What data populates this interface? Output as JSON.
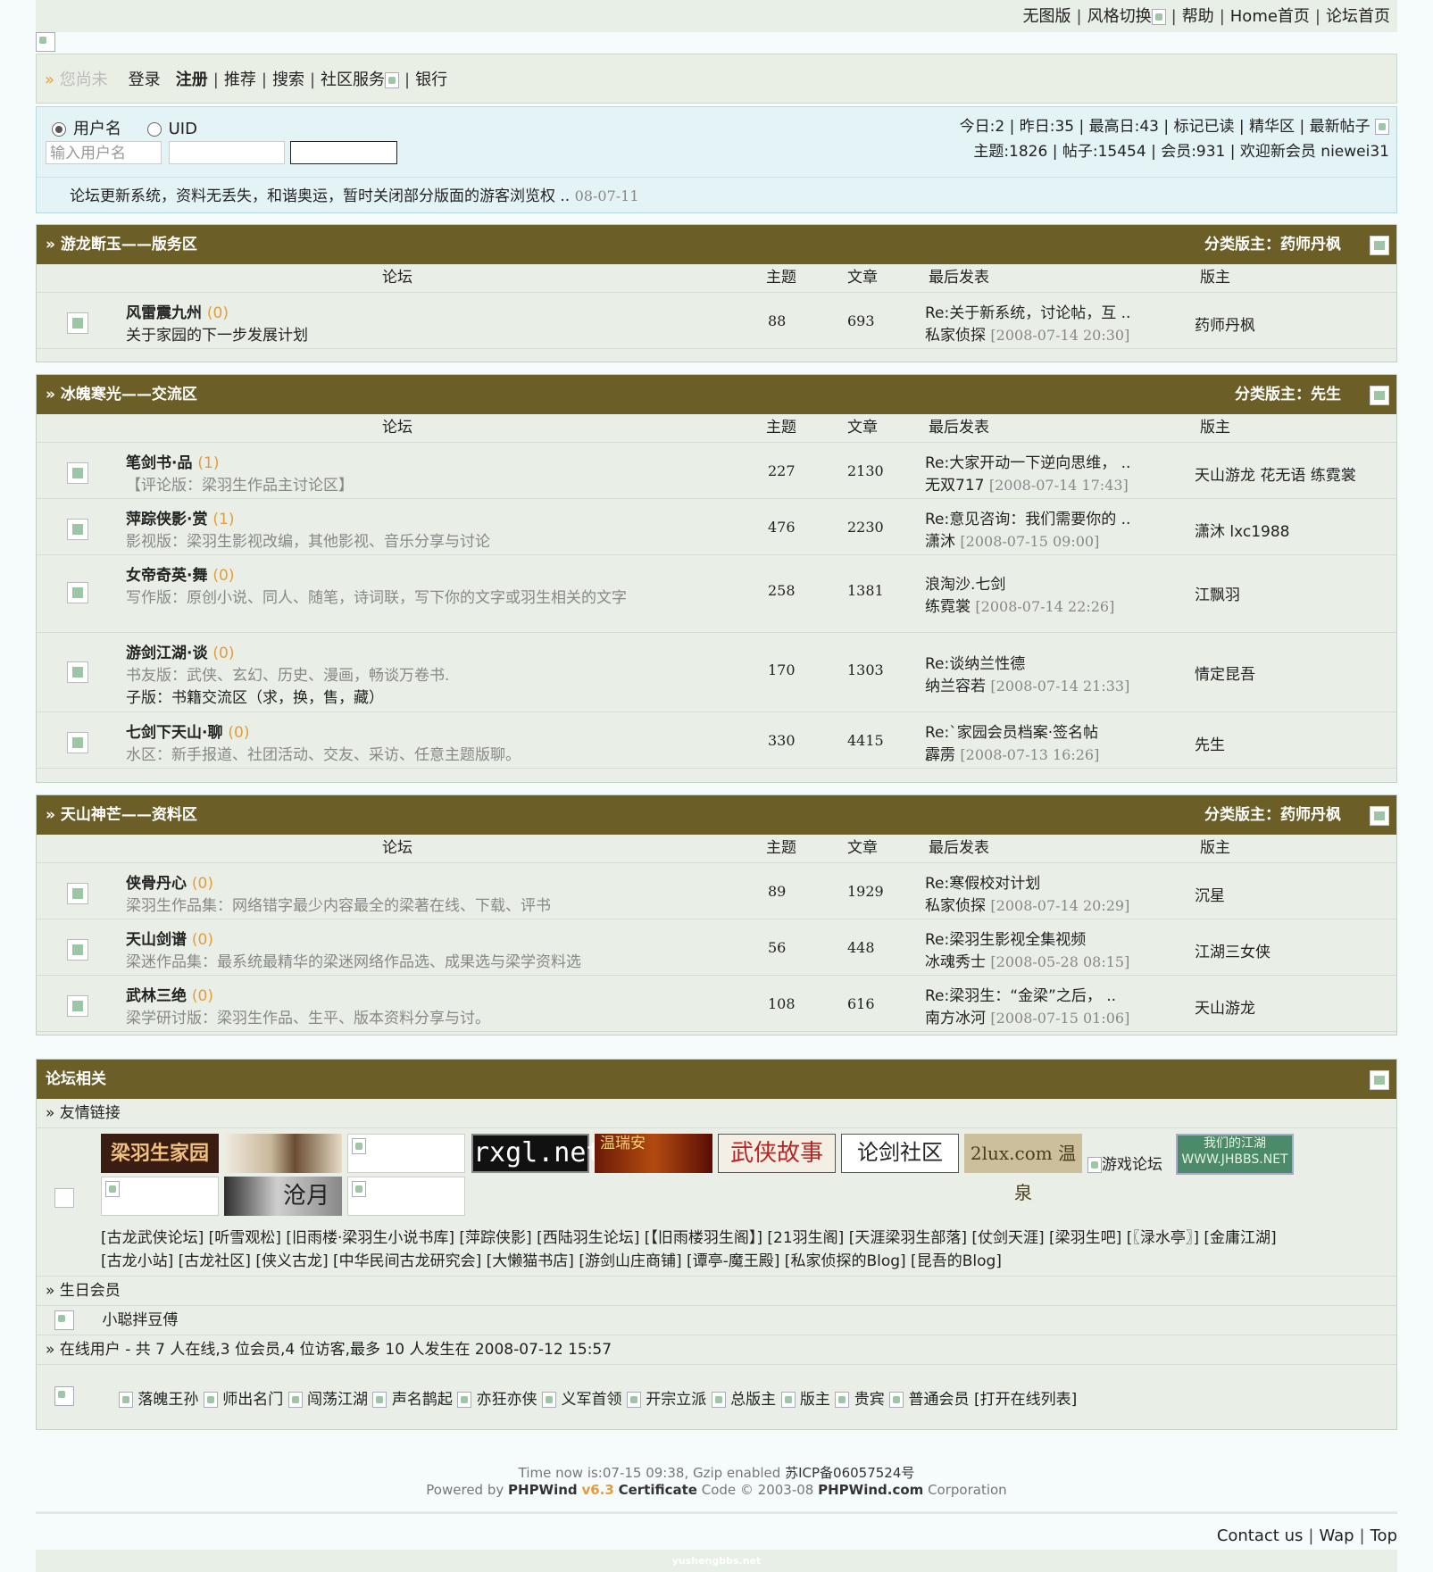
{
  "topbar": {
    "links": [
      "无图版",
      "风格切换",
      "帮助",
      "Home首页",
      "论坛首页"
    ]
  },
  "nav": {
    "greeting_prefix": "» ",
    "greeting": "您尚未",
    "login": "登录",
    "register": "注册",
    "recommend": "推荐",
    "search": "搜索",
    "community": "社区服务",
    "bank": "银行"
  },
  "login": {
    "radio_username": "用户名",
    "radio_uid": "UID",
    "username_placeholder": "输入用户名"
  },
  "stats": {
    "line1": "今日:2 | 昨日:35 | 最高日:43 | 标记已读 | 精华区 | 最新帖子",
    "line2": "主题:1826 | 帖子:15454 | 会员:931 | 欢迎新会员 niewei31"
  },
  "notice": {
    "text": "论坛更新系统，资料无丢失，和谐奥运，暂时关闭部分版面的游客浏览权 ..",
    "date": "08-07-11"
  },
  "columns": {
    "forum": "论坛",
    "topics": "主题",
    "posts": "文章",
    "last": "最后发表",
    "mods": "版主"
  },
  "sections": [
    {
      "title": "» 游龙断玉——版务区",
      "admin": "分类版主：药师丹枫",
      "forums": [
        {
          "name": "风雷震九州",
          "count": "(0)",
          "desc": "关于家园的下一步发展计划",
          "desc_dark": true,
          "topics": "88",
          "posts": "693",
          "last_title": "Re:关于新系统，讨论帖，互 ..",
          "last_user": "私家侦探",
          "last_time": "[2008-07-14 20:30]",
          "mods": "药师丹枫"
        }
      ]
    },
    {
      "title": "» 冰魄寒光——交流区",
      "admin": "分类版主：先生",
      "forums": [
        {
          "name": "笔剑书·品",
          "count": "(1)",
          "desc": "【评论版：梁羽生作品主讨论区】",
          "topics": "227",
          "posts": "2130",
          "last_title": "Re:大家开动一下逆向思维，  ..",
          "last_user": "无双717",
          "last_time": "[2008-07-14 17:43]",
          "mods": "天山游龙 花无语 练霓裳"
        },
        {
          "name": "萍踪侠影·赏",
          "count": "(1)",
          "desc": "影视版：梁羽生影视改编，其他影视、音乐分享与讨论",
          "topics": "476",
          "posts": "2230",
          "last_title": "Re:意见咨询：我们需要你的 ..",
          "last_user": "潇沐",
          "last_time": "[2008-07-15 09:00]",
          "mods": "潇沐 lxc1988"
        },
        {
          "name": "女帝奇英·舞",
          "count": "(0)",
          "desc": "写作版：原创小说、同人、随笔，诗词联，写下你的文字或羽生相关的文字",
          "topics": "258",
          "posts": "1381",
          "last_title": "浪淘沙.七剑",
          "last_user": "练霓裳",
          "last_time": "[2008-07-14 22:26]",
          "mods": "江飘羽"
        },
        {
          "name": "游剑江湖·谈",
          "count": "(0)",
          "desc": "书友版：武侠、玄幻、历史、漫画，畅谈万卷书.",
          "subforum": "子版：书籍交流区（求，换，售，藏）",
          "topics": "170",
          "posts": "1303",
          "last_title": "Re:谈纳兰性德",
          "last_user": "纳兰容若",
          "last_time": "[2008-07-14 21:33]",
          "mods": "情定昆吾"
        },
        {
          "name": "七剑下天山·聊",
          "count": "(0)",
          "desc": "水区：新手报道、社团活动、交友、采访、任意主题版聊。",
          "topics": "330",
          "posts": "4415",
          "last_title": "Re:`家园会员档案·签名帖",
          "last_user": "霹雳",
          "last_time": "[2008-07-13 16:26]",
          "mods": "先生"
        }
      ]
    },
    {
      "title": "» 天山神芒——资料区",
      "admin": "分类版主：药师丹枫",
      "forums": [
        {
          "name": "侠骨丹心",
          "count": "(0)",
          "desc": "梁羽生作品集：网络错字最少内容最全的梁著在线、下载、评书",
          "topics": "89",
          "posts": "1929",
          "last_title": "Re:寒假校对计划",
          "last_user": "私家侦探",
          "last_time": "[2008-07-14 20:29]",
          "mods": "沉星"
        },
        {
          "name": "天山剑谱",
          "count": "(0)",
          "desc": "梁迷作品集：最系统最精华的梁迷网络作品选、成果选与梁学资料选",
          "topics": "56",
          "posts": "448",
          "last_title": "Re:梁羽生影视全集视频",
          "last_user": "冰魂秀士",
          "last_time": "[2008-05-28 08:15]",
          "mods": "江湖三女侠"
        },
        {
          "name": "武林三绝",
          "count": "(0)",
          "desc": "梁学研讨版：梁羽生作品、生平、版本资料分享与讨。",
          "topics": "108",
          "posts": "616",
          "last_title": "Re:梁羽生：“金梁”之后，  ..",
          "last_user": "南方冰河",
          "last_time": "[2008-07-15 01:06]",
          "mods": "天山游龙"
        }
      ]
    }
  ],
  "related": {
    "title": "论坛相关",
    "friend_links": "» 友情链接",
    "img_links": [
      "梁羽生家园",
      "",
      "",
      "rxgl.net",
      "温瑞安",
      "武侠故事",
      "论剑社区",
      "2lux.com 温泉",
      "游戏论坛",
      "我们的江湖 WWW.JHBBS.NET",
      "",
      "沧月",
      ""
    ],
    "text_links_1": "[古龙武侠论坛] [听雪观松] [旧雨楼·梁羽生小说书库] [萍踪侠影] [西陆羽生论坛] [【旧雨楼羽生阁】] [21羽生阁] [天涯梁羽生部落] [仗剑天涯] [梁羽生吧] [〖渌水亭〗] [金庸江湖]",
    "text_links_2": "[古龙小站] [古龙社区] [侠义古龙] [中华民间古龙研究会] [大懒猫书店] [游剑山庄商铺] [谭亭-魔王殿] [私家侦探的Blog] [昆吾的Blog]",
    "birthday": "» 生日会员",
    "birthday_member": "小聪拌豆傅",
    "online": "» 在线用户  - 共 7 人在线,3 位会员,4 位访客,最多 10 人发生在 2008-07-12 15:57",
    "ranks": [
      "落魄王孙",
      "师出名门",
      "闯荡江湖",
      "声名鹊起",
      "亦狂亦侠",
      "义军首领",
      "开宗立派",
      "总版主",
      "版主",
      "贵宾",
      "普通会员"
    ],
    "open_list": "[打开在线列表]"
  },
  "footer": {
    "line1_a": "Time now is:07-15 09:38, Gzip enabled ",
    "line1_b": "苏ICP备06057524号",
    "powered": "Powered by ",
    "brand": "PHPWind",
    "version": "v6.3",
    "cert": "Certificate",
    "code": " Code © 2003-08 ",
    "site": "PHPWind.com",
    "corp": " Corporation"
  },
  "bottom": {
    "links": [
      "Contact us",
      "Wap",
      "Top"
    ],
    "watermark": "yushengbbs.net"
  }
}
